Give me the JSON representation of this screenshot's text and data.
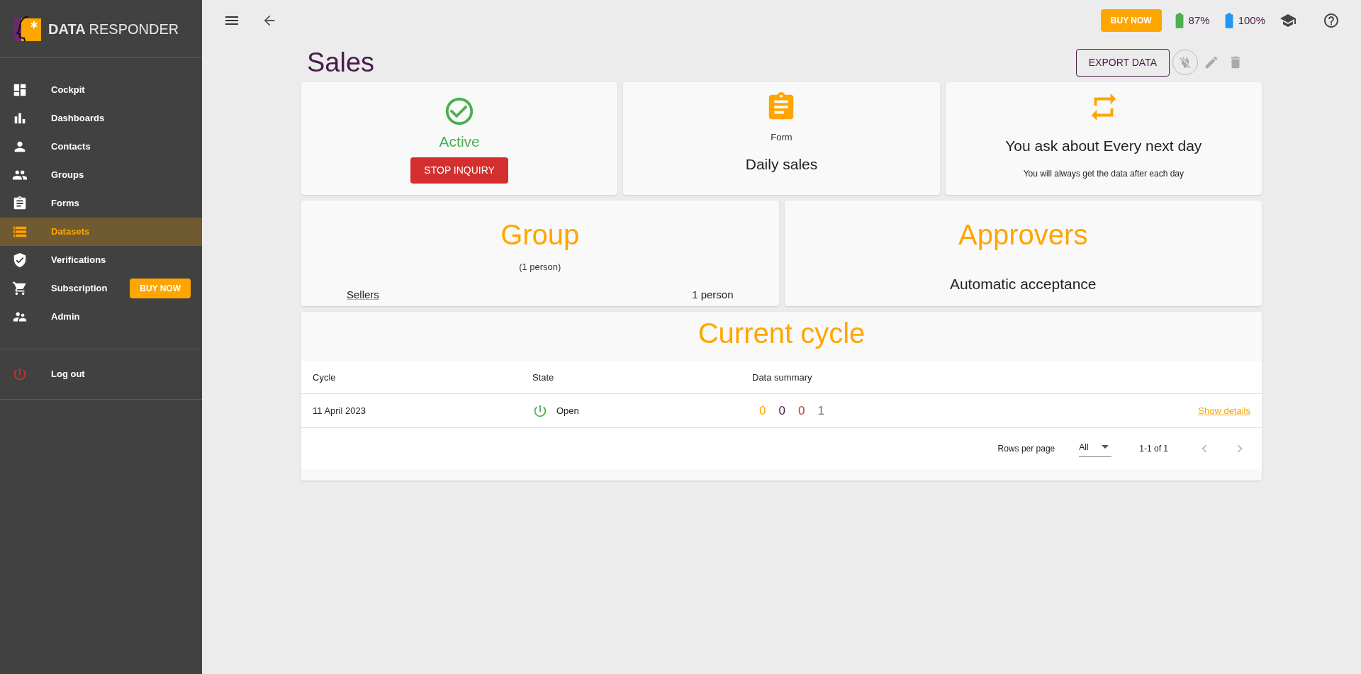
{
  "logo": {
    "bold": "DATA",
    "light": "RESPONDER"
  },
  "sidebar": {
    "items": [
      {
        "label": "Cockpit",
        "kind": "cockpit",
        "selected": false
      },
      {
        "label": "Dashboards",
        "kind": "dashboards",
        "selected": false
      },
      {
        "label": "Contacts",
        "kind": "contacts",
        "selected": false
      },
      {
        "label": "Groups",
        "kind": "groups",
        "selected": false
      },
      {
        "label": "Forms",
        "kind": "forms",
        "selected": false
      },
      {
        "label": "Datasets",
        "kind": "datasets",
        "selected": true
      },
      {
        "label": "Verifications",
        "kind": "verifications",
        "selected": false
      },
      {
        "label": "Subscription",
        "kind": "subscription",
        "selected": false,
        "badge": "BUY NOW"
      },
      {
        "label": "Admin",
        "kind": "admin",
        "selected": false
      }
    ],
    "logout": "Log out"
  },
  "topbar": {
    "buy_now": "BUY NOW",
    "battery_1": "87%",
    "battery_2": "100%"
  },
  "page": {
    "title": "Sales",
    "export": "EXPORT DATA"
  },
  "status_card": {
    "status": "Active",
    "button": "STOP INQUIRY"
  },
  "form_card": {
    "label": "Form",
    "name": "Daily sales"
  },
  "schedule_card": {
    "title": "You ask about Every next day",
    "subtitle": "You will always get the data after each day"
  },
  "group_card": {
    "title": "Group",
    "count": "(1 person)",
    "rows": [
      {
        "name": "Sellers",
        "count": "1 person"
      }
    ]
  },
  "approvers_card": {
    "title": "Approvers",
    "value": "Automatic acceptance"
  },
  "cycle": {
    "title": "Current cycle",
    "columns": [
      "Cycle",
      "State",
      "Data summary"
    ],
    "rows": [
      {
        "cycle": "11 April 2023",
        "state": "Open",
        "summary": [
          {
            "value": "0",
            "color": "#ffa500"
          },
          {
            "value": "0",
            "color": "#4a1a4a"
          },
          {
            "value": "0",
            "color": "#d32f2f"
          },
          {
            "value": "1",
            "color": "#757575"
          }
        ],
        "link": "Show details"
      }
    ],
    "footer": {
      "rows_per_page": "Rows per page",
      "select": "All",
      "range": "1-1 of 1"
    }
  }
}
